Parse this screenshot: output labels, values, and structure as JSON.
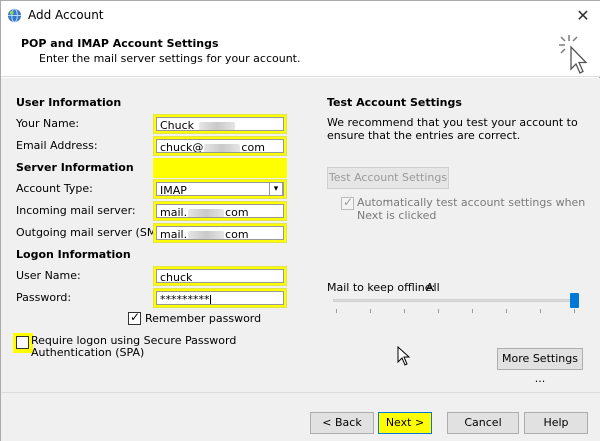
{
  "window": {
    "title": "Add Account",
    "close_label": "✕"
  },
  "header": {
    "title": "POP and IMAP Account Settings",
    "subtitle": "Enter the mail server settings for your account."
  },
  "user_info": {
    "section": "User Information",
    "name_label": "Your Name:",
    "name_value": "Chuck",
    "email_label": "Email Address:",
    "email_prefix": "chuck@",
    "email_suffix": "com"
  },
  "server_info": {
    "section": "Server Information",
    "account_type_label": "Account Type:",
    "account_type_value": "IMAP",
    "incoming_label": "Incoming mail server:",
    "incoming_prefix": "mail.",
    "incoming_suffix": "com",
    "outgoing_label": "Outgoing mail server (SMTP):",
    "outgoing_prefix": "mail.",
    "outgoing_suffix": "com"
  },
  "logon_info": {
    "section": "Logon Information",
    "username_label": "User Name:",
    "username_value": "chuck",
    "password_label": "Password:",
    "password_value": "*********",
    "remember_label": "Remember password",
    "remember_checked": true,
    "spa_label": "Require logon using Secure Password Authentication (SPA)",
    "spa_checked": false
  },
  "test_settings": {
    "section": "Test Account Settings",
    "description": "We recommend that you test your account to ensure that the entries are correct.",
    "test_button": "Test Account Settings ...",
    "auto_test_label": "Automatically test account settings when Next is clicked",
    "auto_test_checked": true
  },
  "offline": {
    "label": "Mail to keep offline:",
    "value": "All",
    "slider_level": 1.0
  },
  "buttons": {
    "more_settings": "More Settings ...",
    "back": "< Back",
    "next": "Next >",
    "cancel": "Cancel",
    "help": "Help"
  },
  "colors": {
    "highlight": "#ffff00",
    "accent": "#0078d7",
    "panel": "#f0f0f0"
  }
}
